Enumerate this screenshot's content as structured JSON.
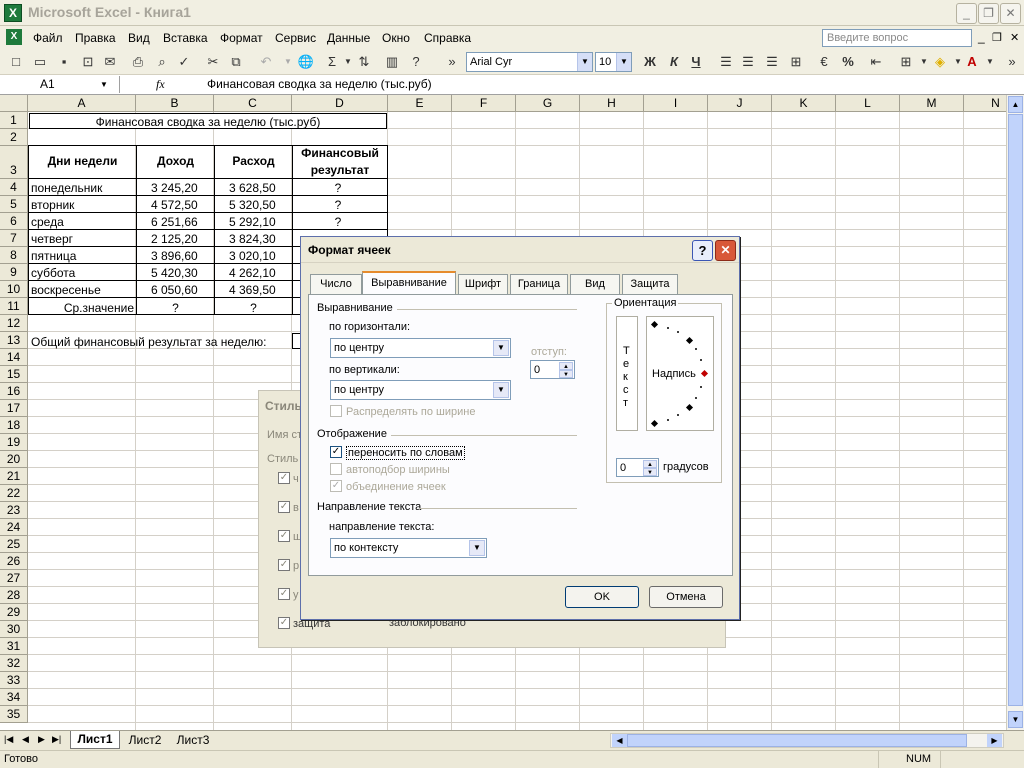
{
  "app": {
    "title": "Microsoft Excel - Книга1",
    "icon": "excel-icon"
  },
  "window_buttons": [
    "minimize-icon",
    "restore-icon",
    "close-icon"
  ],
  "menu": [
    "Файл",
    "Правка",
    "Вид",
    "Вставка",
    "Формат",
    "Сервис",
    "Данные",
    "Окно",
    "Справка"
  ],
  "ask_box": {
    "placeholder": "Введите вопрос"
  },
  "toolbar": {
    "font_name": "Arial Cyr",
    "font_size": "10",
    "bold": "Ж",
    "italic": "К",
    "underline": "Ч",
    "sum": "Σ",
    "percent": "%"
  },
  "formula_bar": {
    "name_box": "A1",
    "fx": "fx",
    "content": "Финансовая сводка за неделю (тыс.руб)"
  },
  "columns": [
    "A",
    "B",
    "C",
    "D",
    "E",
    "F",
    "G",
    "H",
    "I",
    "J",
    "K",
    "L",
    "M",
    "N"
  ],
  "rows": [
    "1",
    "2",
    "3",
    "4",
    "5",
    "6",
    "7",
    "8",
    "9",
    "10",
    "11",
    "12",
    "13",
    "14",
    "15",
    "16",
    "17",
    "18",
    "19",
    "20",
    "21",
    "22",
    "23",
    "24",
    "25",
    "26",
    "27",
    "28",
    "29",
    "30",
    "31",
    "32",
    "33",
    "34",
    "35"
  ],
  "sheet": {
    "title": "Финансовая сводка за неделю (тыс.руб)",
    "headers": [
      "Дни недели",
      "Доход",
      "Расход",
      "Финансовый результат"
    ],
    "data": [
      [
        "понедельник",
        "3 245,20",
        "3 628,50",
        "?"
      ],
      [
        "вторник",
        "4 572,50",
        "5 320,50",
        "?"
      ],
      [
        "среда",
        "6 251,66",
        "5 292,10",
        "?"
      ],
      [
        "четверг",
        "2 125,20",
        "3 824,30",
        ""
      ],
      [
        "пятница",
        "3 896,60",
        "3 020,10",
        ""
      ],
      [
        "суббота",
        "5 420,30",
        "4 262,10",
        ""
      ],
      [
        "воскресенье",
        "6 050,60",
        "4 369,50",
        ""
      ]
    ],
    "avg_label": "Ср.значение",
    "avg_values": [
      "?",
      "?"
    ],
    "total_label": "Общий финансовый результат за неделю:"
  },
  "style_dialog": {
    "title": "Стиль",
    "name_label": "Имя ст",
    "style_label": "Стиль",
    "items": [
      "ч",
      "в",
      "ш",
      "р",
      "у",
      "защита"
    ],
    "protect_value": "заблокировано"
  },
  "format_dialog": {
    "title": "Формат ячеек",
    "tabs": [
      "Число",
      "Выравнивание",
      "Шрифт",
      "Граница",
      "Вид",
      "Защита"
    ],
    "active_tab": "Выравнивание",
    "align_group": "Выравнивание",
    "horizontal_label": "по горизонтали:",
    "horizontal_value": "по центру",
    "vertical_label": "по вертикали:",
    "vertical_value": "по центру",
    "indent_label": "отступ:",
    "indent_value": "0",
    "distribute_label": "Распределять по ширине",
    "display_group": "Отображение",
    "wrap_label": "переносить по словам",
    "wrap_checked": true,
    "shrink_label": "автоподбор ширины",
    "merge_label": "объединение ячеек",
    "direction_group": "Направление текста",
    "direction_label": "направление текста:",
    "direction_value": "по контексту",
    "orientation_group": "Ориентация",
    "vertical_text": [
      "Т",
      "е",
      "к",
      "с",
      "т"
    ],
    "orientation_text": "Надпись",
    "degrees_value": "0",
    "degrees_label": "градусов",
    "ok": "OK",
    "cancel": "Отмена"
  },
  "sheet_tabs": [
    "Лист1",
    "Лист2",
    "Лист3"
  ],
  "active_sheet": "Лист1",
  "status": {
    "left": "Готово",
    "num": "NUM"
  }
}
